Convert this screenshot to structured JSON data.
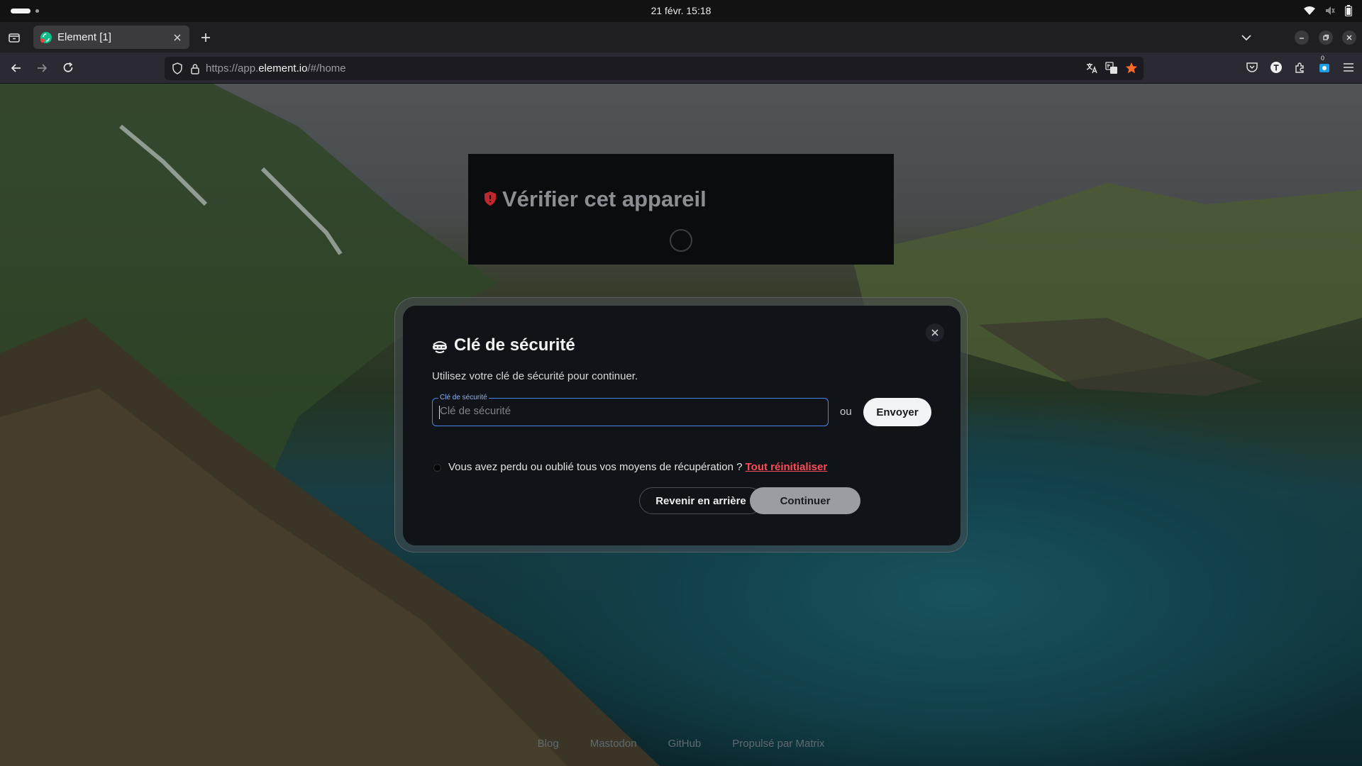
{
  "os": {
    "clock": "21 févr.  15:18"
  },
  "browser": {
    "tab_title": "Element [1]",
    "url_prefix": "https://app.",
    "url_host": "element.io",
    "url_path": "/#/home",
    "badge_count": "0"
  },
  "verify": {
    "title": "Vérifier cet appareil"
  },
  "dialog": {
    "title": "Clé de sécurité",
    "subtitle": "Utilisez votre clé de sécurité pour continuer.",
    "field_label": "Clé de sécurité",
    "field_placeholder": "Clé de sécurité",
    "or": "ou",
    "send": "Envoyer",
    "lost_text": "Vous avez perdu ou oublié tous vos moyens de récupération ? ",
    "lost_link": "Tout réinitialiser",
    "back": "Revenir en arrière",
    "continue": "Continuer"
  },
  "footer": [
    "Blog",
    "Mastodon",
    "GitHub",
    "Propulsé par Matrix"
  ],
  "colors": {
    "accent_link": "#ff4b55",
    "focus_border": "#4a86e8",
    "bookmark_star": "#ff6a2b"
  },
  "icons": [
    "wifi-icon",
    "volume-muted-icon",
    "battery-icon",
    "shield-icon",
    "lock-icon",
    "translate-icon",
    "star-icon",
    "pocket-icon",
    "account-icon",
    "extensions-icon",
    "menu-icon",
    "key-icon",
    "close-icon"
  ]
}
